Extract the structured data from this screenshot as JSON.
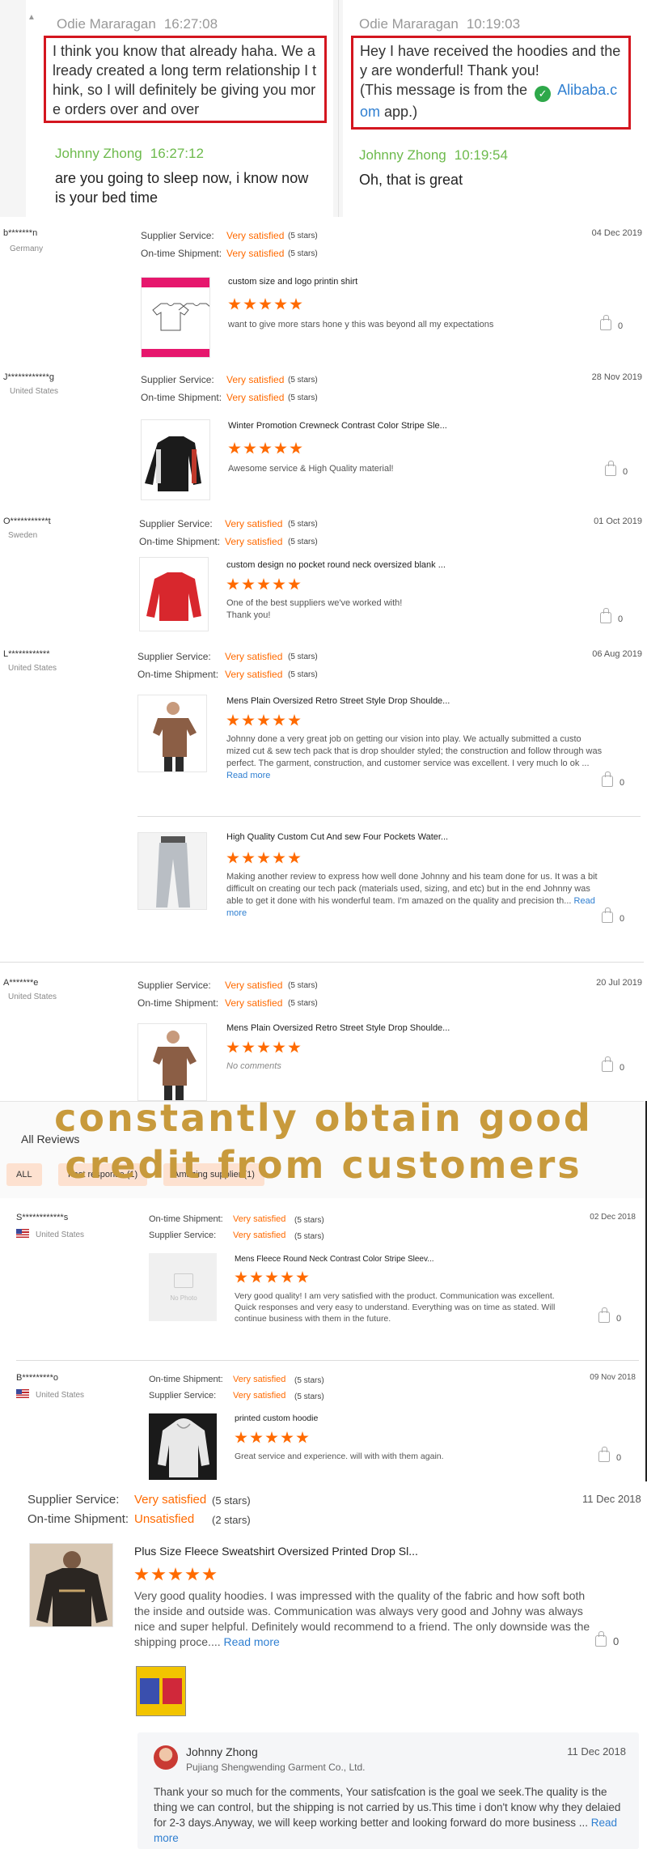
{
  "chat": {
    "left": {
      "msg1": {
        "sender": "Odie Mararagan",
        "time": "16:27:08",
        "text": "I think you know that already haha. We already created a long term relationship I think, so I will definitely be giving you more orders over and over"
      },
      "msg2": {
        "sender": "Johnny Zhong",
        "time": "16:27:12",
        "text": "are you going to sleep now, i know now is your bed time"
      }
    },
    "right": {
      "msg1": {
        "sender": "Odie Mararagan",
        "time": "10:19:03",
        "text": "Hey I have received the hoodies and they are wonderful! Thank you!",
        "note_prefix": "(This message is from the",
        "note_link": "Alibaba.com",
        "note_suffix": "app.)"
      },
      "msg2": {
        "sender": "Johnny Zhong",
        "time": "10:19:54",
        "text": "Oh, that is great"
      }
    }
  },
  "labels": {
    "supplier_service": "Supplier Service:",
    "on_time_shipment": "On-time Shipment:",
    "very_satisfied": "Very satisfied",
    "unsatisfied": "Unsatisfied",
    "five_stars": "(5 stars)",
    "two_stars": "(2 stars)",
    "read_more": "Read more"
  },
  "reviews": [
    {
      "buyer": "b*******n",
      "country": "Germany",
      "date": "04 Dec 2019",
      "product": "custom size and logo printin   shirt",
      "text": "want to give more stars hone   y this was beyond all my expectations",
      "likes": "0",
      "rating": 5
    },
    {
      "buyer": "J************g",
      "country": "United States",
      "date": "28 Nov 2019",
      "product": "Winter Promotion Crewneck Contrast Color Stripe Sle...",
      "text": "Awesome service & High Quality material!",
      "likes": "0",
      "rating": 5
    },
    {
      "buyer": "O***********t",
      "country": "Sweden",
      "date": "01 Oct 2019",
      "product": "custom design no pocket round neck oversized blank ...",
      "text": "One of the best suppliers we've worked with!\nThank you!",
      "likes": "0",
      "rating": 5
    },
    {
      "buyer": "L************",
      "country": "United States",
      "date": "06 Aug 2019",
      "product": "Mens Plain Oversized Retro Street Style Drop Shoulde...",
      "text": "Johnny done a very great job on getting our vision into play. We actually submitted a custo mized cut & sew tech pack that is drop shoulder styled; the construction and follow through was perfect. The garment, construction, and customer service was excellent. I very much lo ok ...",
      "likes": "0",
      "rating": 5
    },
    {
      "buyer": "",
      "country": "",
      "date": "",
      "product": "High Quality Custom Cut And sew Four Pockets Water...",
      "text": "Making another review to express how well done Johnny and his team done for us. It was a bit difficult on creating our tech pack (materials used, sizing, and etc) but in the end Johnny was able to get it done with his wonderful team. I'm amazed on the quality and precision th...",
      "likes": "0",
      "rating": 5
    },
    {
      "buyer": "A*******e",
      "country": "United States",
      "date": "20 Jul 2019",
      "product": "Mens Plain Oversized Retro Street Style Drop Shoulde...",
      "text": "No comments",
      "likes": "0",
      "rating": 5
    }
  ],
  "headline": {
    "line1": "constantly obtain good",
    "line2": "credit from customers"
  },
  "all_reviews": {
    "title": "All Reviews",
    "chips": [
      "ALL",
      "Fast response (1)",
      "Amazing supplier (1)"
    ],
    "items": [
      {
        "buyer": "S************s",
        "country": "United States",
        "date": "02 Dec 2018",
        "product": "Mens Fleece Round Neck Contrast Color Stripe Sleev...",
        "no_photo": "No Photo",
        "text": "Very good quality! I am very satisfied with the product. Communication was excellent. Quick responses and very easy to understand. Everything was on time as stated. Will continue business with them in the future.",
        "likes": "0",
        "rating": 5
      },
      {
        "buyer": "B*********o",
        "country": "United States",
        "date": "09 Nov 2018",
        "product": "printed custom hoodie",
        "text": "Great service and experience. will with with them again.",
        "likes": "0",
        "rating": 5
      }
    ]
  },
  "big_review": {
    "date": "11 Dec 2018",
    "product": "Plus Size Fleece Sweatshirt Oversized Printed Drop Sl...",
    "text": "Very good quality hoodies. I was impressed with the quality of the fabric and how soft both the inside and outside was. Communication was always very good and Johny was always nice and super helpful. Definitely would recommend to a friend. The only downside was the shipping proce....",
    "likes": "0",
    "rating": 5,
    "reply": {
      "name": "Johnny Zhong",
      "company": "Pujiang Shengwending Garment Co., Ltd.",
      "date": "11 Dec 2018",
      "text": "Thank your so much for the comments, Your satisfcation is the goal we seek.The quality is the thing we can control, but the shipping is not carried by us.This time i don't know why they delaied for 2-3 days.Anyway, we will keep working better and looking forward do more business ..."
    }
  },
  "colors": {
    "accent_orange": "#ff6a00",
    "highlight_red": "#d4161f",
    "link_blue": "#2f7fd1",
    "headline_gold": "#c89a3c",
    "sender_green": "#6dba4c"
  }
}
